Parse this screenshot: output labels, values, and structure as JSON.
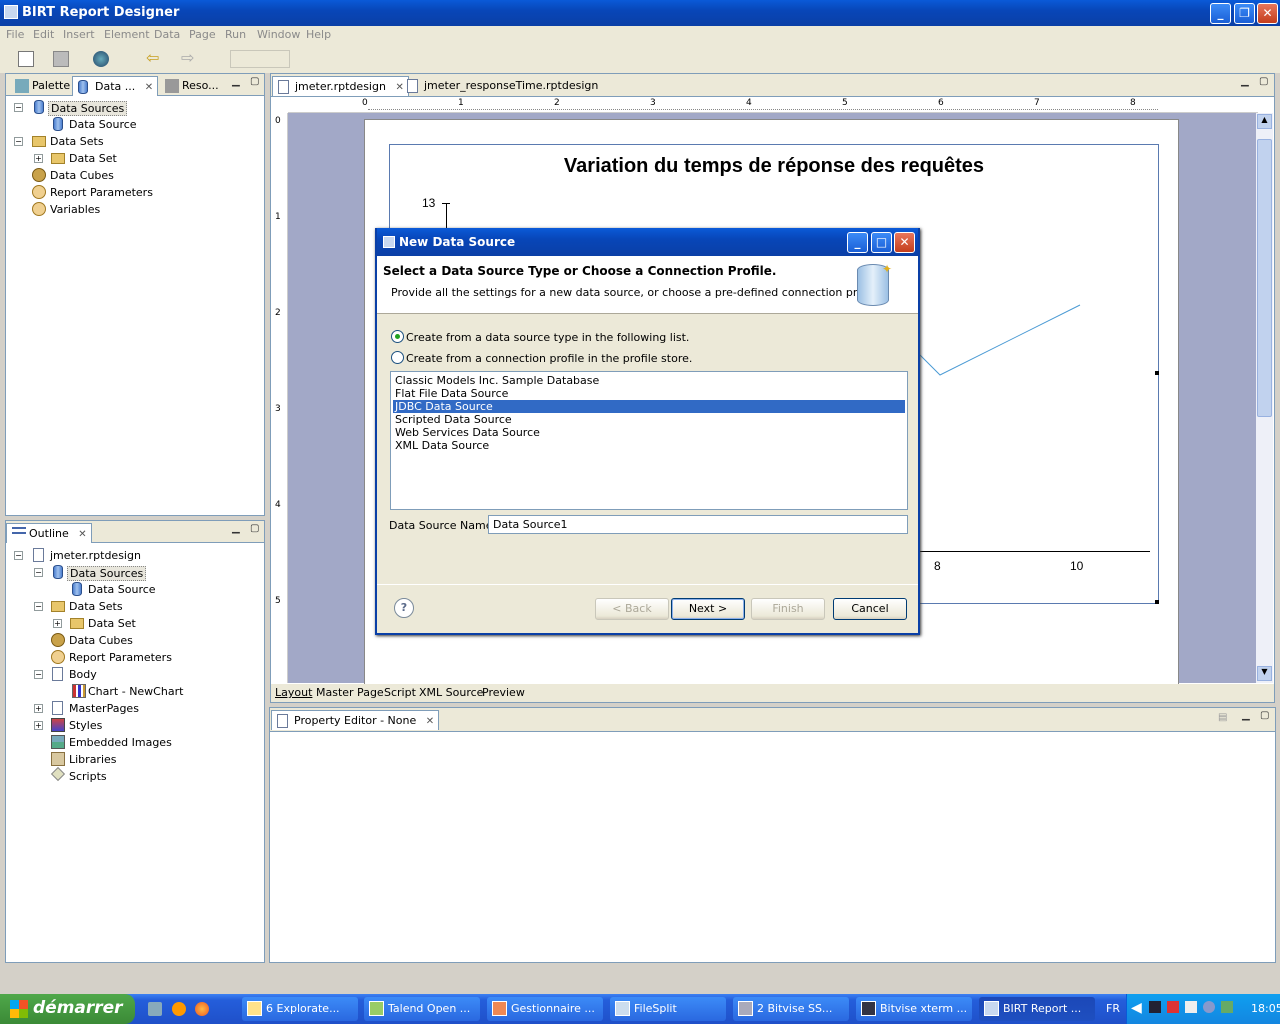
{
  "window": {
    "title": "BIRT Report Designer"
  },
  "menu": [
    "File",
    "Edit",
    "Insert",
    "Element",
    "Data",
    "Page",
    "Run",
    "Window",
    "Help"
  ],
  "left_top_panel": {
    "tabs": [
      "Palette",
      "Data ...",
      "Reso..."
    ],
    "tree": [
      {
        "label": "Data Sources",
        "level": 0
      },
      {
        "label": "Data Source",
        "level": 1
      },
      {
        "label": "Data Sets",
        "level": 0
      },
      {
        "label": "Data Set",
        "level": 1
      },
      {
        "label": "Data Cubes",
        "level": 0
      },
      {
        "label": "Report Parameters",
        "level": 0
      },
      {
        "label": "Variables",
        "level": 0
      }
    ]
  },
  "outline_panel": {
    "tab": "Outline",
    "tree": [
      {
        "label": "jmeter.rptdesign",
        "level": 0
      },
      {
        "label": "Data Sources",
        "level": 1
      },
      {
        "label": "Data Source",
        "level": 2
      },
      {
        "label": "Data Sets",
        "level": 1
      },
      {
        "label": "Data Set",
        "level": 2
      },
      {
        "label": "Data Cubes",
        "level": 1
      },
      {
        "label": "Report Parameters",
        "level": 1
      },
      {
        "label": "Body",
        "level": 1
      },
      {
        "label": "Chart - NewChart",
        "level": 2
      },
      {
        "label": "MasterPages",
        "level": 1
      },
      {
        "label": "Styles",
        "level": 1
      },
      {
        "label": "Embedded Images",
        "level": 1
      },
      {
        "label": "Libraries",
        "level": 1
      },
      {
        "label": "Scripts",
        "level": 1
      }
    ]
  },
  "editor": {
    "tabs": [
      "jmeter.rptdesign",
      "jmeter_responseTime.rptdesign"
    ],
    "ruler_marks": [
      "0",
      "1",
      "2",
      "3",
      "4",
      "5",
      "6",
      "7",
      "8"
    ],
    "vruler_marks": [
      "0",
      "1",
      "2",
      "3",
      "4",
      "5"
    ],
    "chart_title": "Variation du temps de réponse des requêtes",
    "y_tick_label": "13",
    "x_tick_labels": [
      "8",
      "10"
    ],
    "bottom_tabs": [
      "Layout",
      "Master Page",
      "Script",
      "XML Source",
      "Preview"
    ]
  },
  "property_editor": {
    "tab": "Property Editor - None"
  },
  "dialog": {
    "title": "New Data Source",
    "header_title": "Select a Data Source Type or Choose a Connection Profile.",
    "header_desc": "Provide all the settings for a new data source, or choose a pre-defined connection profile.",
    "radio_type": "Create from a data source type in the following list.",
    "radio_profile": "Create from a connection profile in the profile store.",
    "types": [
      "Classic Models Inc. Sample Database",
      "Flat File Data Source",
      "JDBC Data Source",
      "Scripted Data Source",
      "Web Services Data Source",
      "XML Data Source"
    ],
    "selected_type": "JDBC Data Source",
    "name_label": "Data Source Name:",
    "name_value": "Data Source1",
    "buttons": {
      "back": "< Back",
      "next": "Next >",
      "finish": "Finish",
      "cancel": "Cancel"
    },
    "help_glyph": "?"
  },
  "taskbar": {
    "start": "démarrer",
    "tasks": [
      "6 Explorate...",
      "Talend Open ...",
      "Gestionnaire ...",
      "FileSplit",
      "2 Bitvise SS...",
      "Bitvise xterm ...",
      "BIRT Report ..."
    ],
    "lang": "FR",
    "clock": "18:05"
  },
  "colors": {
    "accent": "#0a3fa6",
    "selection": "#316ac5",
    "canvas": "#a2a8c7",
    "chart_line": "#4a9ad4"
  }
}
